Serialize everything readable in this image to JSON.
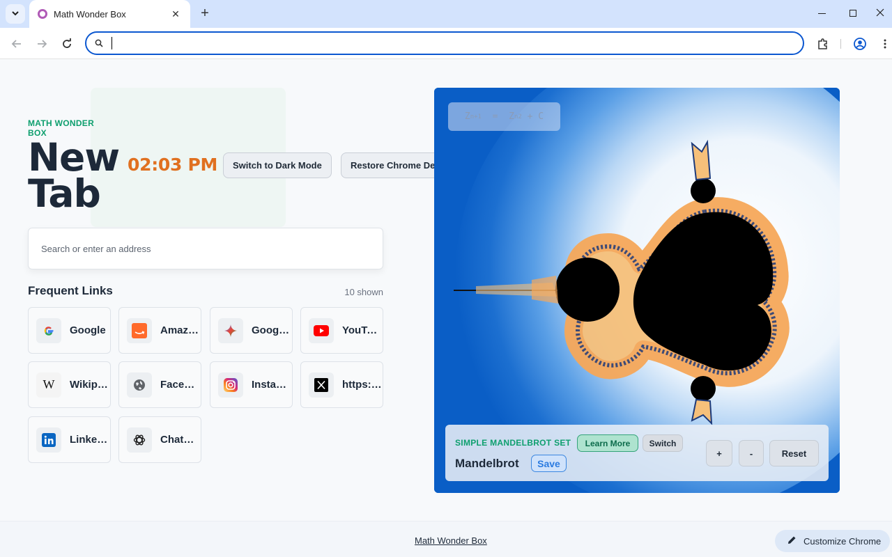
{
  "browser": {
    "tab_title": "Math Wonder Box",
    "new_tab_symbol": "+",
    "close_symbol": "✕",
    "omnibox_value": ""
  },
  "hero": {
    "brand": "MATH WONDER BOX",
    "title": "New Tab",
    "clock": "02:03 PM",
    "dark_mode_button": "Switch to Dark Mode",
    "restore_button": "Restore Chrome Defaults"
  },
  "search": {
    "placeholder": "Search or enter an address"
  },
  "links": {
    "heading": "Frequent Links",
    "count": "10 shown",
    "items": [
      {
        "label": "Google",
        "icon": "google-icon"
      },
      {
        "label": "Amazon",
        "icon": "amazon-icon"
      },
      {
        "label": "Google Gemini",
        "icon": "gemini-icon"
      },
      {
        "label": "YouTube",
        "icon": "youtube-icon"
      },
      {
        "label": "Wikipedia",
        "icon": "wikipedia-icon"
      },
      {
        "label": "Facebook",
        "icon": "globe-icon"
      },
      {
        "label": "Instagram",
        "icon": "instagram-icon"
      },
      {
        "label": "https://x.com",
        "icon": "x-icon"
      },
      {
        "label": "LinkedIn",
        "icon": "linkedin-icon"
      },
      {
        "label": "ChatGPT",
        "icon": "chatgpt-icon"
      }
    ]
  },
  "fractal": {
    "formula_lhs": "Z",
    "formula_lhs_sub": "n+1",
    "formula_eq": "=",
    "formula_rhs": "Z",
    "formula_rhs_sub": "n",
    "formula_rhs_sup": "2",
    "formula_tail": "+ C",
    "set_label": "SIMPLE MANDELBROT SET",
    "learn_more": "Learn More",
    "switch": "Switch",
    "name": "Mandelbrot",
    "save": "Save",
    "zoom_in": "+",
    "zoom_out": "-",
    "reset": "Reset"
  },
  "footer": {
    "link": "Math Wonder Box",
    "customize": "Customize Chrome"
  },
  "colors": {
    "brand_green": "#0e9f6e",
    "clock_orange": "#e07020",
    "fractal_blue": "#0a5ec6",
    "omnibox_border": "#0b57d0"
  }
}
